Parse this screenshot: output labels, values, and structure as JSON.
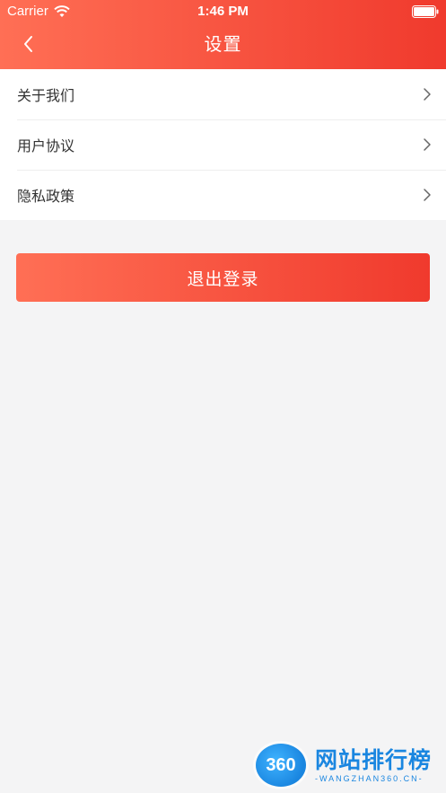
{
  "status_bar": {
    "carrier": "Carrier",
    "time": "1:46 PM"
  },
  "nav": {
    "title": "设置"
  },
  "settings": {
    "items": [
      {
        "label": "关于我们"
      },
      {
        "label": "用户协议"
      },
      {
        "label": "隐私政策"
      }
    ]
  },
  "actions": {
    "logout_label": "退出登录"
  },
  "watermark": {
    "badge": "360",
    "title": "网站排行榜",
    "subtitle": "-WANGZHAN360.CN-"
  },
  "colors": {
    "accent_start": "#ff6f55",
    "accent_end": "#f03a2d",
    "background": "#f4f4f5",
    "watermark_blue": "#1a86e0"
  }
}
